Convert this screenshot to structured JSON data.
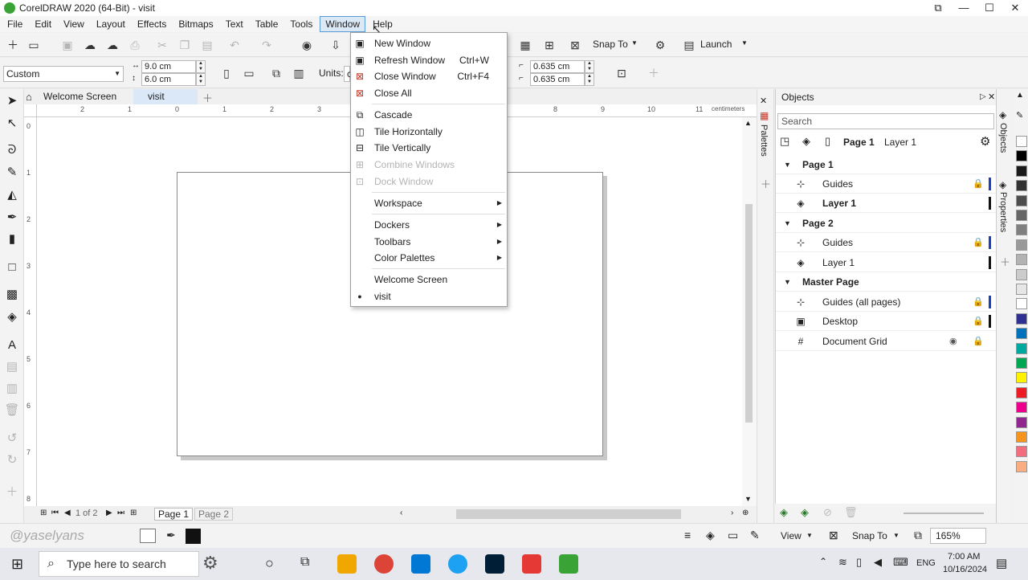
{
  "window": {
    "title": "CorelDRAW 2020 (64-Bit) - visit",
    "min": "—",
    "max": "☐",
    "close": "✕",
    "restore": "⧉"
  },
  "menubar": [
    "File",
    "Edit",
    "View",
    "Layout",
    "Effects",
    "Bitmaps",
    "Text",
    "Table",
    "Tools",
    "Window",
    "Help"
  ],
  "toolbar1": {
    "snap_to": "Snap To",
    "launch": "Launch"
  },
  "toolbar2": {
    "preset": "Custom",
    "width": "9.0 cm",
    "height": "6.0 cm",
    "units_label": "Units:",
    "units_value": "c",
    "nudge_x": "0.635 cm",
    "nudge_y": "0.635 cm"
  },
  "tabs": {
    "welcome": "Welcome Screen",
    "doc": "visit"
  },
  "ruler": {
    "unit": "centimeters",
    "h_labels": [
      "2",
      "1",
      "0",
      "1",
      "2",
      "3",
      "8",
      "9",
      "10",
      "11"
    ],
    "v_labels": [
      "0",
      "1",
      "2",
      "3",
      "4",
      "5",
      "6",
      "7",
      "8"
    ]
  },
  "page_nav": {
    "counter": "1 of 2",
    "page1": "Page 1",
    "page2": "Page 2"
  },
  "window_menu": {
    "items": [
      {
        "label": "New Window",
        "shortcut": ""
      },
      {
        "label": "Refresh Window",
        "shortcut": "Ctrl+W"
      },
      {
        "label": "Close Window",
        "shortcut": "Ctrl+F4"
      },
      {
        "label": "Close All",
        "shortcut": ""
      },
      {
        "label": "Cascade",
        "shortcut": ""
      },
      {
        "label": "Tile Horizontally",
        "shortcut": ""
      },
      {
        "label": "Tile Vertically",
        "shortcut": ""
      },
      {
        "label": "Combine Windows",
        "shortcut": ""
      },
      {
        "label": "Dock Window",
        "shortcut": ""
      },
      {
        "label": "Workspace",
        "shortcut": ""
      },
      {
        "label": "Dockers",
        "shortcut": ""
      },
      {
        "label": "Toolbars",
        "shortcut": ""
      },
      {
        "label": "Color Palettes",
        "shortcut": ""
      },
      {
        "label": "Welcome Screen",
        "shortcut": ""
      },
      {
        "label": "visit",
        "shortcut": ""
      }
    ]
  },
  "palettes_tab": "Palettes",
  "objects_panel": {
    "title": "Objects",
    "search_placeholder": "Search",
    "current_page": "Page 1",
    "current_layer": "Layer 1",
    "rows": [
      {
        "label": "Page 1"
      },
      {
        "label": "Guides"
      },
      {
        "label": "Layer 1"
      },
      {
        "label": "Page 2"
      },
      {
        "label": "Guides"
      },
      {
        "label": "Layer 1"
      },
      {
        "label": "Master Page"
      },
      {
        "label": "Guides (all pages)"
      },
      {
        "label": "Desktop"
      },
      {
        "label": "Document Grid"
      }
    ],
    "colors": {
      "blue": "#1d3fbf",
      "black": "#111111"
    }
  },
  "dock_tabs": {
    "objects": "Objects",
    "properties": "Properties"
  },
  "palette_colors": [
    "#ffffff",
    "#000000",
    "#1a1a1a",
    "#333333",
    "#4d4d4d",
    "#666666",
    "#808080",
    "#999999",
    "#b3b3b3",
    "#cccccc",
    "#e6e6e6",
    "#ffffff",
    "#2e3192",
    "#0072bc",
    "#00a99d",
    "#00a651",
    "#fff200",
    "#ed1c24",
    "#ec008c",
    "#92278f",
    "#f7941d",
    "#f26d7d",
    "#f9ad81"
  ],
  "statusbar": {
    "watermark": "@yaselyans",
    "view": "View",
    "snap_to": "Snap To",
    "zoom": "165%"
  },
  "taskbar": {
    "search_placeholder": "Type here to search",
    "lang": "ENG",
    "time": "7:00 AM",
    "date": "10/16/2024",
    "app_colors": [
      "#f0a800",
      "#db4437",
      "#0078d4",
      "#1da1f2",
      "#001e36",
      "#e53935",
      "#3aa335"
    ]
  }
}
